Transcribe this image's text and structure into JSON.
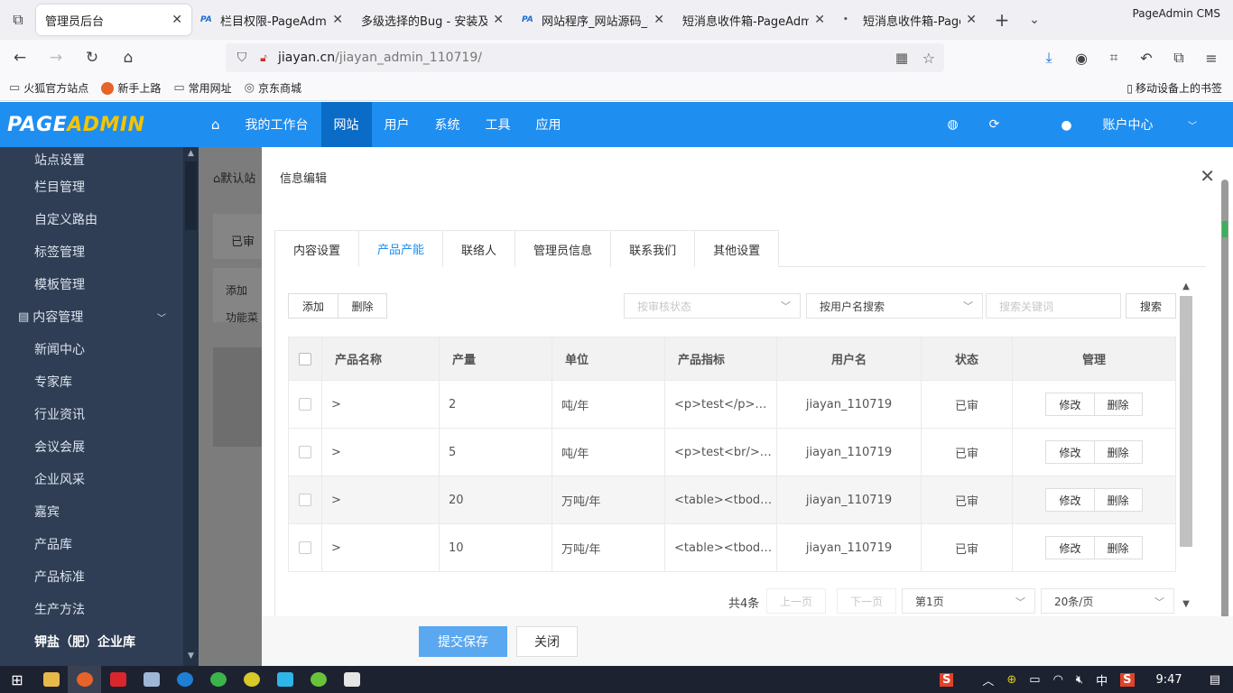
{
  "browser": {
    "window_menu_icon": "window-icon",
    "tabs": [
      {
        "title": "管理员后台",
        "favicon": "",
        "active": true
      },
      {
        "title": "栏目权限-PageAdmin",
        "favicon": "PA",
        "active": false
      },
      {
        "title": "多级选择的Bug - 安装及使",
        "favicon": "",
        "active": false
      },
      {
        "title": "网站程序_网站源码_建",
        "favicon": "PA",
        "active": false
      },
      {
        "title": "短消息收件箱-PageAdmin",
        "favicon": "",
        "active": false
      },
      {
        "title": "短消息收件箱-PageAd",
        "favicon": "•",
        "active": false
      }
    ],
    "new_tab": "+",
    "list_tabs": "⌄",
    "window_title": "PageAdmin CMS",
    "close_glyph": "✕",
    "url_host": "jiayan.cn",
    "url_path": "/jiayan_admin_110719/",
    "bookmarks": [
      {
        "label": "火狐官方站点",
        "icon": "folder-icon"
      },
      {
        "label": "新手上路",
        "icon": "firefox-icon"
      },
      {
        "label": "常用网址",
        "icon": "folder-icon"
      },
      {
        "label": "京东商城",
        "icon": "globe-icon"
      }
    ],
    "mobile_bookmarks": "移动设备上的书签"
  },
  "app": {
    "logo_main": "PAGE",
    "logo_accent": "ADMIN",
    "nav": [
      {
        "label": "我的工作台",
        "active": false
      },
      {
        "label": "网站",
        "active": true
      },
      {
        "label": "用户",
        "active": false
      },
      {
        "label": "系统",
        "active": false
      },
      {
        "label": "工具",
        "active": false
      },
      {
        "label": "应用",
        "active": false
      }
    ],
    "account": "账户中心"
  },
  "sidebar": {
    "items_top": [
      "站点设置",
      "栏目管理",
      "自定义路由",
      "标签管理",
      "模板管理"
    ],
    "group": "内容管理",
    "items_content": [
      "新闻中心",
      "专家库",
      "行业资讯",
      "会议会展",
      "企业风采",
      "嘉宾",
      "产品库",
      "产品标准",
      "生产方法",
      "钾盐（肥）企业库"
    ]
  },
  "background": {
    "breadcrumb": "默认站",
    "status_tab": "已审",
    "add": "添加",
    "func": "功能菜"
  },
  "modal": {
    "title": "信息编辑",
    "tabs": [
      {
        "label": "内容设置",
        "active": false
      },
      {
        "label": "产品产能",
        "active": true
      },
      {
        "label": "联络人",
        "active": false
      },
      {
        "label": "管理员信息",
        "active": false
      },
      {
        "label": "联系我们",
        "active": false
      },
      {
        "label": "其他设置",
        "active": false
      }
    ],
    "toolbar": {
      "add": "添加",
      "delete": "删除"
    },
    "filter1_placeholder": "按审核状态",
    "filter2_value": "按用户名搜索",
    "search_placeholder": "搜索关键词",
    "search_button": "搜索",
    "table": {
      "headers": [
        "产品名称",
        "产量",
        "单位",
        "产品指标",
        "用户名",
        "状态",
        "管理"
      ],
      "rows": [
        {
          "name": ">",
          "qty": "2",
          "unit": "吨/年",
          "spec": "<p>test</p><br/>...",
          "user": "jiayan_110719",
          "status": "已审"
        },
        {
          "name": ">",
          "qty": "5",
          "unit": "吨/年",
          "spec": "<p>test<br/><br/>...",
          "user": "jiayan_110719",
          "status": "已审"
        },
        {
          "name": ">",
          "qty": "20",
          "unit": "万吨/年",
          "spec": "<table><tbody>...",
          "user": "jiayan_110719",
          "status": "已审"
        },
        {
          "name": ">",
          "qty": "10",
          "unit": "万吨/年",
          "spec": "<table><tbody>...",
          "user": "jiayan_110719",
          "status": "已审"
        }
      ],
      "edit_label": "修改",
      "delete_label": "删除"
    },
    "pager": {
      "total": "共4条",
      "prev": "上一页",
      "next": "下一页",
      "page": "第1页",
      "size": "20条/页"
    },
    "footer": {
      "save": "提交保存",
      "close": "关闭"
    }
  },
  "taskbar": {
    "time": "9:47",
    "ime": "中"
  }
}
